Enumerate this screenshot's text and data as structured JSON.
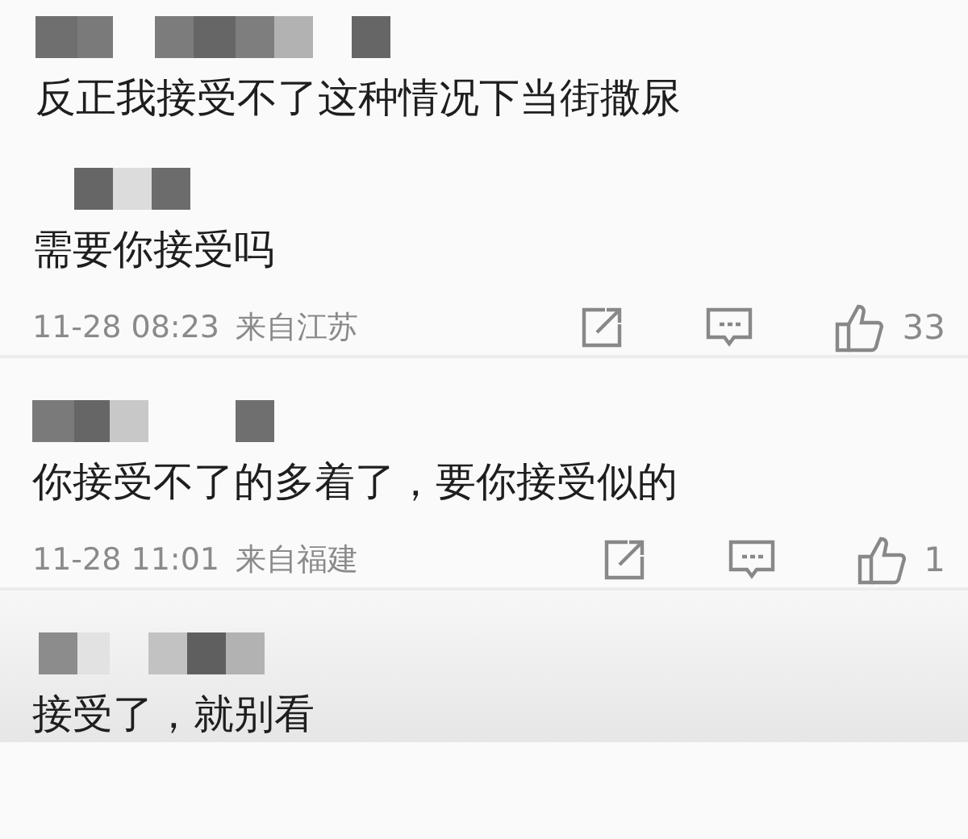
{
  "comments": [
    {
      "author_hidden": true,
      "text": "反正我接受不了这种情况下当街撒尿"
    },
    {
      "author_hidden": true,
      "text": "需要你接受吗",
      "meta": {
        "time": "11-28 08:23",
        "location": "来自江苏",
        "likes": "33"
      }
    },
    {
      "author_hidden": true,
      "text": "你接受不了的多着了，要你接受似的",
      "meta": {
        "time": "11-28 11:01",
        "location": "来自福建",
        "likes": "1"
      }
    },
    {
      "author_hidden": true,
      "text": "接受了，就别看"
    }
  ]
}
